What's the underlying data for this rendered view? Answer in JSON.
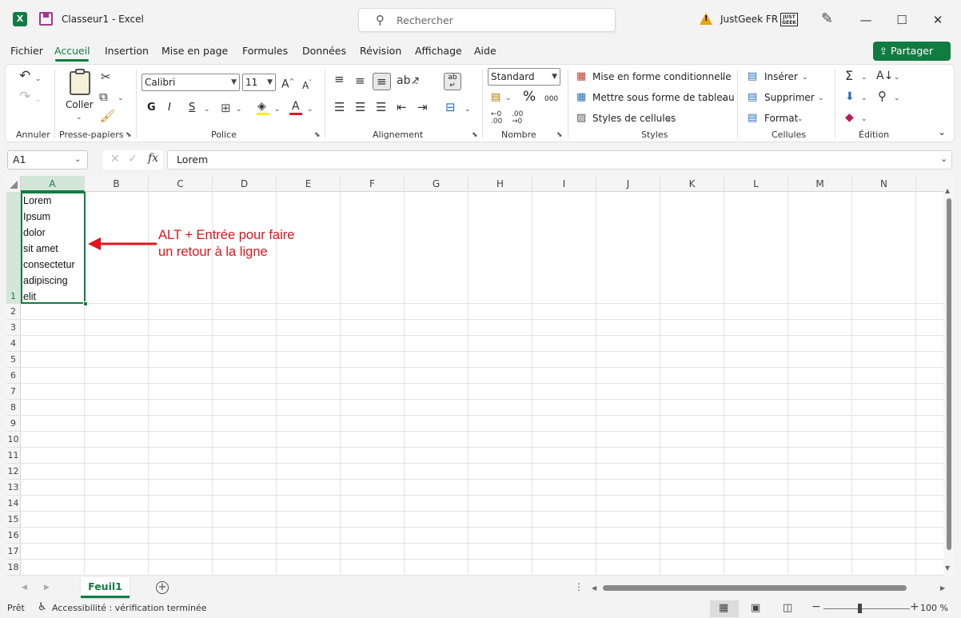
{
  "window": {
    "app_icon_letter": "X",
    "title": "Classeur1  -  Excel",
    "search_placeholder": "Rechercher",
    "user_name": "JustGeek FR",
    "user_logo_text": "JUST GEEK",
    "min_glyph": "—",
    "max_glyph": "☐",
    "close_glyph": "✕",
    "accent_color": "#107c41"
  },
  "menu": {
    "tabs": [
      "Fichier",
      "Accueil",
      "Insertion",
      "Mise en page",
      "Formules",
      "Données",
      "Révision",
      "Affichage",
      "Aide"
    ],
    "active": "Accueil",
    "share_label": "Partager"
  },
  "ribbon": {
    "groups": {
      "undo": "Annuler",
      "clipboard": "Presse-papiers",
      "font": "Police",
      "alignment": "Alignement",
      "number": "Nombre",
      "styles": "Styles",
      "cells": "Cellules",
      "editing": "Édition"
    },
    "paste_label": "Coller",
    "font_name": "Calibri",
    "font_size": "11",
    "bold_label": "G",
    "italic_label": "I",
    "underline_label": "S",
    "number_format": "Standard",
    "percent_label": "%",
    "thousands_label": "000",
    "conditional_format": "Mise en forme conditionnelle",
    "format_as_table": "Mettre sous forme de tableau",
    "cell_styles": "Styles de cellules",
    "insert": "Insérer",
    "delete": "Supprimer",
    "format": "Format"
  },
  "formula_bar": {
    "name_box": "A1",
    "fx": "fx",
    "content": "Lorem"
  },
  "grid": {
    "columns": [
      "A",
      "B",
      "C",
      "D",
      "E",
      "F",
      "G",
      "H",
      "I",
      "J",
      "K",
      "L",
      "M",
      "N"
    ],
    "rows": [
      "1",
      "2",
      "3",
      "4",
      "5",
      "6",
      "7",
      "8",
      "9",
      "10",
      "11",
      "12",
      "13",
      "14",
      "15",
      "16",
      "17",
      "18"
    ],
    "cell_a1": "Lorem\nIpsum\ndolor\nsit amet\nconsectetur\nadipiscing\nelit",
    "annotation": "ALT + Entrée pour faire\nun retour à la ligne",
    "annotation_color": "#e0141b"
  },
  "sheets": {
    "tabs": [
      "Feuil1"
    ],
    "active": "Feuil1"
  },
  "status": {
    "ready": "Prêt",
    "accessibility": "Accessibilité : vérification terminée",
    "zoom": "100 %"
  }
}
